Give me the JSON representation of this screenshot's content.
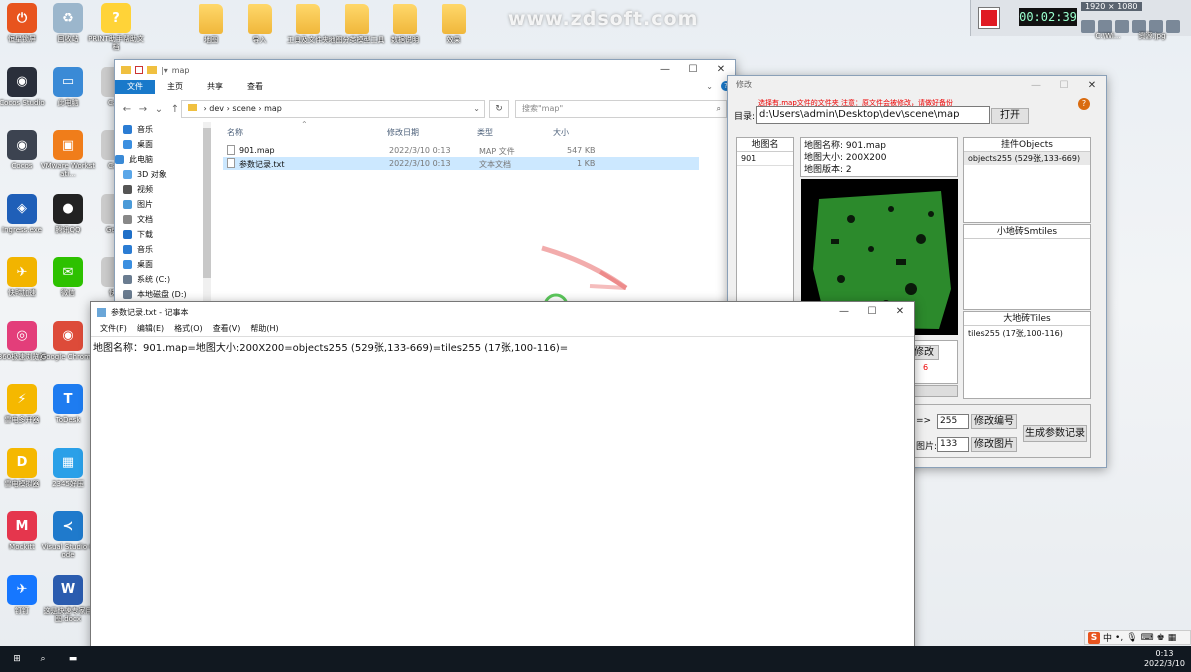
{
  "watermark": "www.zdsoft.com",
  "recorder": {
    "time": "00:02:39",
    "resolution": "1920 × 1080"
  },
  "desktop": {
    "left_icons": [
      {
        "label": "恒星锁屏",
        "color": "#e8541e",
        "glyph": "⏻"
      },
      {
        "label": "Cocos Studio",
        "color": "#2a2f3b",
        "glyph": "◉"
      },
      {
        "label": "Cocos",
        "color": "#3c4350",
        "glyph": "◉"
      },
      {
        "label": "Ingress.exe",
        "color": "#1f5fb8",
        "glyph": "◈"
      },
      {
        "label": "快鸭加速",
        "color": "#f2b400",
        "glyph": "✈"
      },
      {
        "label": "360极速浏览器",
        "color": "#e33e7a",
        "glyph": "◎"
      },
      {
        "label": "雷电多开器",
        "color": "#f5b800",
        "glyph": "⚡"
      },
      {
        "label": "雷电模拟器",
        "color": "#f5b800",
        "glyph": "D"
      },
      {
        "label": "Mockitt",
        "color": "#e5364d",
        "glyph": "M"
      },
      {
        "label": "钉钉",
        "color": "#1677ff",
        "glyph": "✈"
      }
    ],
    "second_icons": [
      {
        "label": "回收站",
        "color": "#9bb6cc",
        "glyph": "♻"
      },
      {
        "label": "此电脑",
        "color": "#3a8ad6",
        "glyph": "▭"
      },
      {
        "label": "VMware Workstati...",
        "color": "#f07d1a",
        "glyph": "▣"
      },
      {
        "label": "腾讯QQ",
        "color": "#222",
        "glyph": "●"
      },
      {
        "label": "微信",
        "color": "#2dc100",
        "glyph": "✉"
      },
      {
        "label": "Google Chrome",
        "color": "#dd4b39",
        "glyph": "◉"
      },
      {
        "label": "ToDesk",
        "color": "#1e7cf0",
        "glyph": "T"
      },
      {
        "label": "2345好压",
        "color": "#2aa0e8",
        "glyph": "▦"
      },
      {
        "label": "Visual Studio Code",
        "color": "#1f7acc",
        "glyph": "≺"
      },
      {
        "label": "这是快速专家用图.docx",
        "color": "#2b5caf",
        "glyph": "W"
      }
    ],
    "third_icons": [
      {
        "label": "PRINT助手帮助文档",
        "color": "#ffd338",
        "glyph": "?"
      },
      {
        "label": "Cam",
        "color": "#ccc",
        "glyph": ""
      },
      {
        "label": "Cam",
        "color": "#ccc",
        "glyph": ""
      },
      {
        "label": "GeeM",
        "color": "#ccc",
        "glyph": ""
      },
      {
        "label": "快鸭",
        "color": "#ccc",
        "glyph": ""
      }
    ],
    "folders": [
      "地图",
      "导入",
      "工具及文件夹",
      "地图分类模型工具",
      "数据说明",
      "效果"
    ],
    "top_right_labels": [
      "C:\\Wi...",
      "资源.jpg"
    ]
  },
  "explorer": {
    "title": "map",
    "ribbon": [
      "文件",
      "主页",
      "共享",
      "查看"
    ],
    "breadcrumb": [
      "dev",
      "scene",
      "map"
    ],
    "search_placeholder": "搜索\"map\"",
    "nav": [
      {
        "label": "音乐",
        "color": "#2b7cd3"
      },
      {
        "label": "桌面",
        "color": "#3b8fe0"
      },
      {
        "label": "此电脑",
        "color": "#3a8ad6"
      },
      {
        "label": "3D 对象",
        "color": "#5aa6e8"
      },
      {
        "label": "视频",
        "color": "#555"
      },
      {
        "label": "图片",
        "color": "#4a9ad8"
      },
      {
        "label": "文档",
        "color": "#888"
      },
      {
        "label": "下载",
        "color": "#1f6fc8"
      },
      {
        "label": "音乐",
        "color": "#2b7cd3"
      },
      {
        "label": "桌面",
        "color": "#3b8fe0"
      },
      {
        "label": "系统 (C:)",
        "color": "#6a7c90"
      },
      {
        "label": "本地磁盘 (D:)",
        "color": "#6a7c90"
      }
    ],
    "columns": [
      "名称",
      "修改日期",
      "类型",
      "大小"
    ],
    "files": [
      {
        "name": "901.map",
        "date": "2022/3/10 0:13",
        "type": "MAP 文件",
        "size": "547 KB"
      },
      {
        "name": "参数记录.txt",
        "date": "2022/3/10 0:13",
        "type": "文本文档",
        "size": "1 KB"
      }
    ]
  },
  "tool": {
    "title_fragment": "修改",
    "hint": "选择有.map文件的文件夹     注意：原文件会被修改，请做好备份",
    "dir_label": "目录:",
    "dir_value": "d:\\Users\\admin\\Desktop\\dev\\scene\\map",
    "open_button": "打开",
    "list_header": "地图名",
    "list_items": [
      "901"
    ],
    "info": [
      "地图名称: 901.map",
      "地图大小: 200X200",
      "地图版本: 2"
    ],
    "objects_header": "挂件Objects",
    "objects_items": [
      "objects255 (529张,133-669)"
    ],
    "small_tiles_header": "小地砖Smtiles",
    "big_tiles_header": "大地砖Tiles",
    "big_tiles_items": [
      "tiles255 (17张,100-116)"
    ],
    "edit_button": "修改",
    "red_number": "6",
    "arrow_label": "=>",
    "num_value": "255",
    "edit_num_button": "修改编号",
    "pic_label": "图片:",
    "pic_value": "133",
    "edit_pic_button": "修改图片",
    "gen_button": "生成参数记录"
  },
  "notepad": {
    "title": "参数记录.txt - 记事本",
    "menu": [
      "文件(F)",
      "编辑(E)",
      "格式(O)",
      "查看(V)",
      "帮助(H)"
    ],
    "content": "地图名称：901.map=地图大小:200X200=objects255 (529张,133-669)=tiles255 (17张,100-116)="
  },
  "taskbar": {
    "ime": "中",
    "time": "0:13",
    "date": "2022/3/10"
  }
}
